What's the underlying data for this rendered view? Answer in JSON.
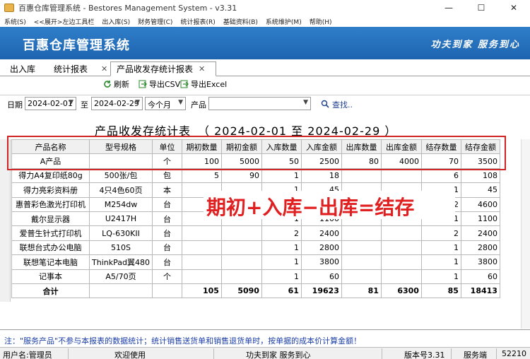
{
  "window": {
    "title": "百惠仓库管理系统 - Bestores Management System - v3.31",
    "minimize": "—",
    "maximize": "☐",
    "close": "✕"
  },
  "menu": [
    "系统(S)",
    "<<展开>左边工具栏",
    "出入库(S)",
    "财务管理(C)",
    "统计报表(R)",
    "基础资料(B)",
    "系统维护(M)",
    "帮助(H)"
  ],
  "banner": {
    "app_title": "百惠仓库管理系统",
    "slogan": "功夫到家 服务到心"
  },
  "tabs": [
    {
      "label": "出入库"
    },
    {
      "label": "统计报表"
    },
    {
      "label": "产品收发存统计报表",
      "close": "✕",
      "active": true
    }
  ],
  "toolbar": {
    "refresh": "刷新",
    "export_csv": "导出CSV",
    "export_excel": "导出Excel"
  },
  "filter": {
    "date_label": "日期",
    "start_date": "2024-02-01",
    "to_label": "至",
    "end_date": "2024-02-29",
    "period": "今个月",
    "product_label": "产品",
    "product_value": "",
    "search": "查找.."
  },
  "report": {
    "title": "产品收发存统计表",
    "date_range": "（ 2024-02-01  至  2024-02-29 ）",
    "columns": [
      "产品名称",
      "型号规格",
      "单位",
      "期初数量",
      "期初金额",
      "入库数量",
      "入库金额",
      "出库数量",
      "出库金额",
      "结存数量",
      "结存金额"
    ],
    "rows": [
      [
        "A产品",
        "",
        "个",
        "100",
        "5000",
        "50",
        "2500",
        "80",
        "4000",
        "70",
        "3500"
      ],
      [
        "得力A4复印纸80g",
        "500张/包",
        "包",
        "5",
        "90",
        "1",
        "18",
        "",
        "",
        "6",
        "108"
      ],
      [
        "得力亮彩资料册",
        "4只4色60页",
        "本",
        "",
        "",
        "1",
        "45",
        "",
        "",
        "1",
        "45"
      ],
      [
        "惠普彩色激光打印机",
        "M254dw",
        "台",
        "",
        "",
        "3",
        "6900",
        "",
        "2300",
        "2",
        "4600"
      ],
      [
        "戴尔显示器",
        "U2417H",
        "台",
        "",
        "",
        "1",
        "1100",
        "",
        "",
        "1",
        "1100"
      ],
      [
        "爱普生针式打印机",
        "LQ-630KII",
        "台",
        "",
        "",
        "2",
        "2400",
        "",
        "",
        "2",
        "2400"
      ],
      [
        "联想台式办公电脑",
        "510S",
        "台",
        "",
        "",
        "1",
        "2800",
        "",
        "",
        "1",
        "2800"
      ],
      [
        "联想笔记本电脑",
        "ThinkPad翼480",
        "台",
        "",
        "",
        "1",
        "3800",
        "",
        "",
        "1",
        "3800"
      ],
      [
        "记事本",
        "A5/70页",
        "个",
        "",
        "",
        "1",
        "60",
        "",
        "",
        "1",
        "60"
      ]
    ],
    "total": [
      "合计",
      "",
      "",
      "105",
      "5090",
      "61",
      "19623",
      "81",
      "6300",
      "85",
      "18413"
    ]
  },
  "annotation": "期初+入库−出库=结存",
  "note": "注：\"服务产品\"不参与本报表的数据统计；统计销售送货单和销售退货单时，按单据的成本价计算金额！",
  "status": {
    "user": "用户名:管理员",
    "welcome": "欢迎使用",
    "slogan": "功夫到家 服务到心",
    "version": "版本号3.31",
    "service": "服务端",
    "port": "52210"
  },
  "colors": {
    "banner": "#1e64b0",
    "annotation": "#e02020",
    "note": "#1c3fa8",
    "highlight": "#d02424"
  }
}
